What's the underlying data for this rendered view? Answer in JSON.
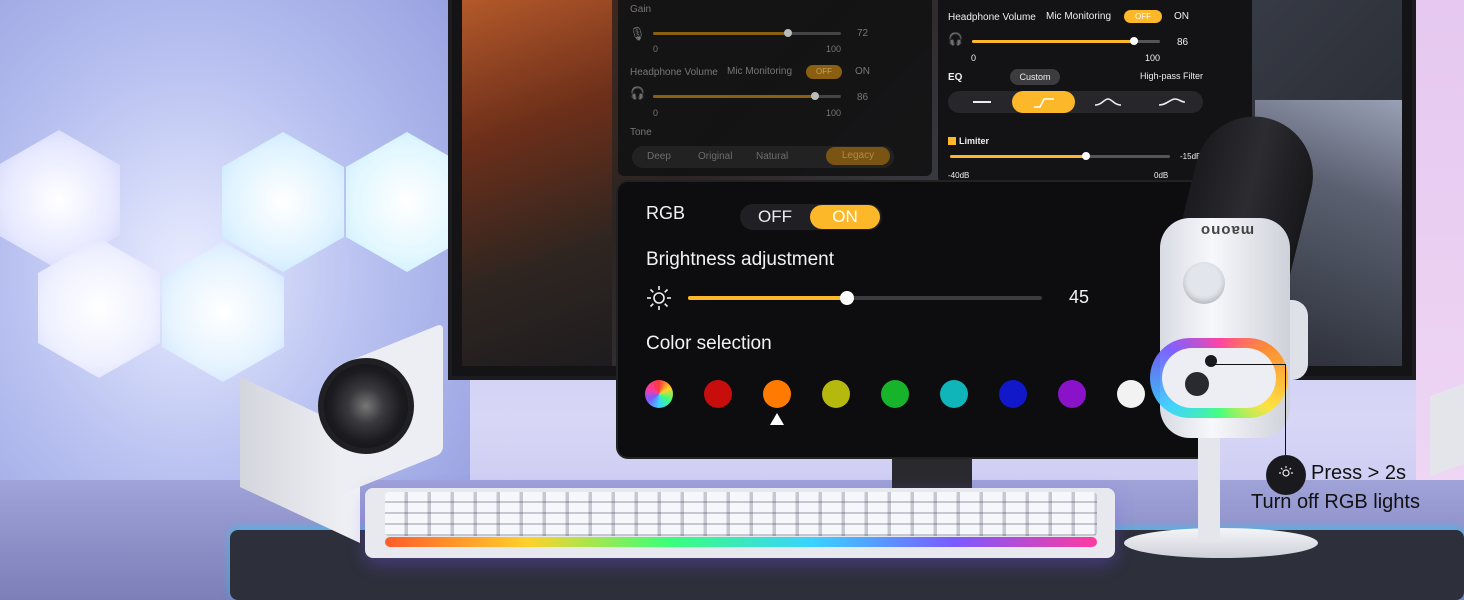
{
  "panel_top_left": {
    "gain_label": "Gain",
    "gain_value": "72",
    "gain_min": "0",
    "gain_max": "100",
    "gain_level": 0.72,
    "headphone_label": "Headphone Volume",
    "mic_monitoring_label": "Mic Monitoring",
    "off_label": "OFF",
    "on_label": "ON",
    "hp_value": "86",
    "hp_min": "0",
    "hp_max": "100",
    "hp_level": 0.86,
    "tone_label": "Tone",
    "tone_options": [
      "Deep",
      "Original",
      "Natural",
      "Legacy"
    ],
    "tone_selected": "Legacy"
  },
  "panel_top_right": {
    "headphone_label": "Headphone Volume",
    "mic_monitoring_label": "Mic Monitoring",
    "off_label": "OFF",
    "on_label": "ON",
    "hp_value": "86",
    "hp_min": "0",
    "hp_max": "100",
    "hp_level": 0.86,
    "eq_label": "EQ",
    "eq_preset": "Custom",
    "highpass_label": "High-pass Filter",
    "limiter_label": "Limiter",
    "limiter_value": "-15dB",
    "limiter_min": "-40dB",
    "limiter_max": "0dB"
  },
  "panel_rgb": {
    "rgb_label": "RGB",
    "off_label": "OFF",
    "on_label": "ON",
    "brightness_label": "Brightness adjustment",
    "brightness_value": "45",
    "brightness_level": 0.45,
    "color_label": "Color selection",
    "colors": [
      {
        "name": "rainbow",
        "hex": "rainbow"
      },
      {
        "name": "red",
        "hex": "#c80d0d"
      },
      {
        "name": "orange",
        "hex": "#ff7a00"
      },
      {
        "name": "yellow",
        "hex": "#b5b80d"
      },
      {
        "name": "green",
        "hex": "#17b42b"
      },
      {
        "name": "cyan",
        "hex": "#0fb5b8"
      },
      {
        "name": "blue",
        "hex": "#1018c9"
      },
      {
        "name": "purple",
        "hex": "#8a12c8"
      },
      {
        "name": "white",
        "hex": "#f2f2f2"
      }
    ],
    "selected_color_index": 2
  },
  "colors": {
    "accent": "#fdb829",
    "dim_accent": "#8a5f12"
  },
  "mic": {
    "brand": "maono"
  },
  "callout": {
    "line1": "Press > 2s",
    "line2": "Turn off RGB lights"
  }
}
